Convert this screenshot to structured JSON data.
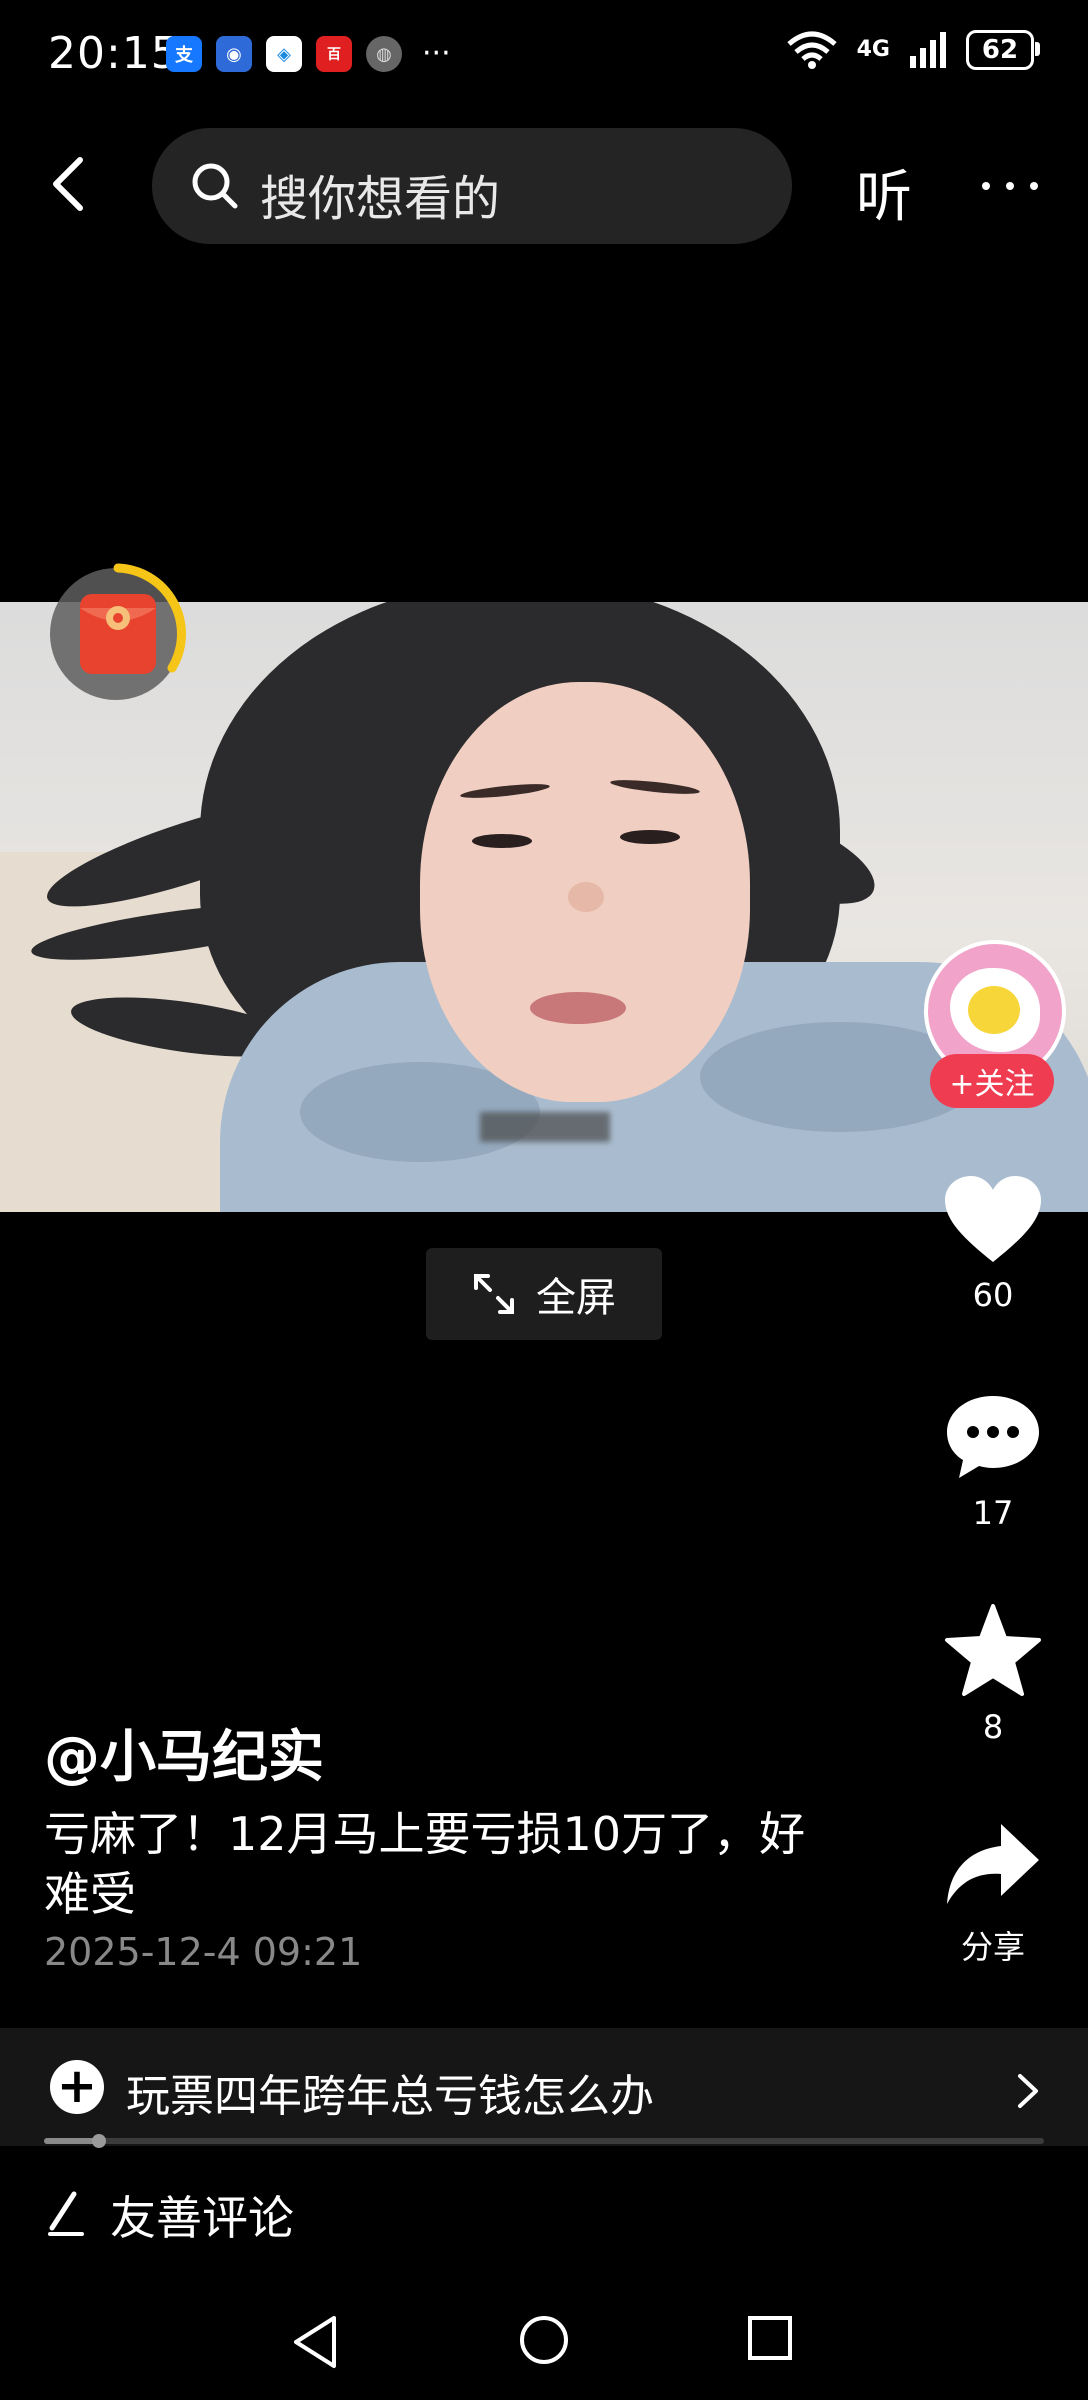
{
  "status_bar": {
    "time": "20:15",
    "battery": "62",
    "network": "4G",
    "notification_icons": [
      {
        "name": "alipay-icon",
        "color": "#1677ff",
        "glyph": "支"
      },
      {
        "name": "app-blue-icon",
        "color": "#2f6bd8",
        "glyph": "◉"
      },
      {
        "name": "safari-like-icon",
        "color": "#ffffff",
        "glyph": "◈"
      },
      {
        "name": "baidu-news-icon",
        "color": "#e02020",
        "glyph": "百"
      },
      {
        "name": "avatar-notif-icon",
        "color": "#777777",
        "glyph": "◍"
      }
    ]
  },
  "top_bar": {
    "search_placeholder": "搜你想看的",
    "listen_label": "听"
  },
  "video": {
    "fullscreen_label": "全屏"
  },
  "actions": {
    "follow_label": "+关注",
    "likes": "60",
    "comments": "17",
    "favorites": "8",
    "share_label": "分享"
  },
  "post": {
    "author": "@小马纪实",
    "description": "亏麻了！12月马上要亏损10万了，好难受",
    "timestamp": "2025-12-4 09:21"
  },
  "topic": {
    "text": "玩票四年跨年总亏钱怎么办"
  },
  "playback": {
    "progress": 0.055
  },
  "comment": {
    "placeholder": "友善评论"
  },
  "colors": {
    "follow_red": "#ef3c50",
    "avatar_pink": "#f2a3c9",
    "packet_red": "#e8432e",
    "ring_yellow": "#f5c518"
  }
}
